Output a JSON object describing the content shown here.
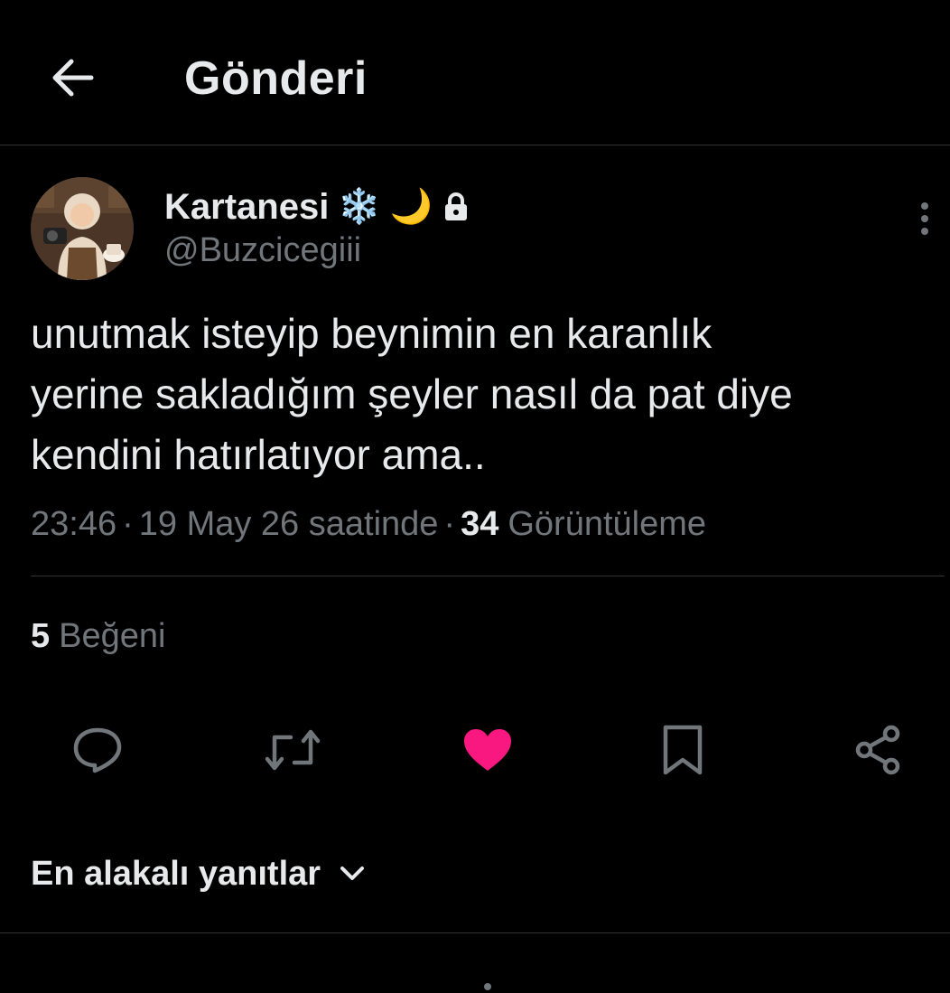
{
  "header": {
    "title": "Gönderi"
  },
  "author": {
    "display_name": "Kartanesi",
    "name_emoji_1": "❄️",
    "name_emoji_2": "🌙",
    "handle": "@Buzcicegiii",
    "avatar_icon": "avatar-illustration"
  },
  "tweet": {
    "text": "unutmak isteyip beynimin en karanlık\nyerine sakladığım şeyler nasıl da pat diye\nkendini hatırlatıyor ama..",
    "time": "23:46",
    "separator": "·",
    "date": "19 May 26 saatinde",
    "views_count": "34",
    "views_label": "Görüntüleme",
    "likes_count": "5",
    "likes_label": "Beğeni"
  },
  "actions": {
    "reply_icon": "reply-icon",
    "retweet_icon": "retweet-icon",
    "like_icon": "heart-icon",
    "bookmark_icon": "bookmark-icon",
    "share_icon": "share-icon"
  },
  "replies": {
    "sort_label": "En alakalı yanıtlar"
  },
  "colors": {
    "background": "#000000",
    "text_primary": "#e7e9ea",
    "text_secondary": "#71767b",
    "divider": "#2f3336",
    "like_active": "#f91880"
  }
}
